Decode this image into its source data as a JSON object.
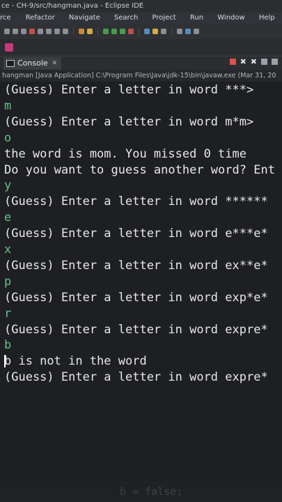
{
  "window": {
    "title": "ce - CH-9/src/hangman.java - Eclipse IDE"
  },
  "menu": {
    "items": [
      "rce",
      "Refactor",
      "Navigate",
      "Search",
      "Project",
      "Run",
      "Window",
      "Help"
    ]
  },
  "tab": {
    "label": "Console"
  },
  "launch": {
    "path": "hangman [Java Application] C:\\Program Files\\Java\\jdk-15\\bin\\javaw.exe  (Mar 31, 20"
  },
  "console": {
    "lines": [
      {
        "text": "(Guess) Enter a letter in word ***>",
        "type": "out"
      },
      {
        "text": "m",
        "type": "in"
      },
      {
        "text": "(Guess) Enter a letter in word m*m>",
        "type": "out"
      },
      {
        "text": "o",
        "type": "in"
      },
      {
        "text": "the word is mom. You missed 0 time",
        "type": "out"
      },
      {
        "text": "Do you want to guess another word? Ent",
        "type": "out"
      },
      {
        "text": "y",
        "type": "in"
      },
      {
        "text": "(Guess) Enter a letter in word ******",
        "type": "out"
      },
      {
        "text": "e",
        "type": "in"
      },
      {
        "text": "(Guess) Enter a letter in word e***e*",
        "type": "out"
      },
      {
        "text": "x",
        "type": "in"
      },
      {
        "text": "(Guess) Enter a letter in word ex**e*",
        "type": "out"
      },
      {
        "text": "p",
        "type": "in"
      },
      {
        "text": "(Guess) Enter a letter in word exp*e*",
        "type": "out"
      },
      {
        "text": "r",
        "type": "in"
      },
      {
        "text": "(Guess) Enter a letter in word expre*",
        "type": "out"
      },
      {
        "text": "b",
        "type": "in"
      },
      {
        "text": "b is not in the word",
        "type": "out"
      },
      {
        "text": "(Guess) Enter a letter in word expre*",
        "type": "out"
      }
    ]
  },
  "ghost_code": "b = false;",
  "colors": {
    "console_bg": "#1e1f22",
    "output_text": "#e8e8e8",
    "input_text": "#67c08c"
  }
}
